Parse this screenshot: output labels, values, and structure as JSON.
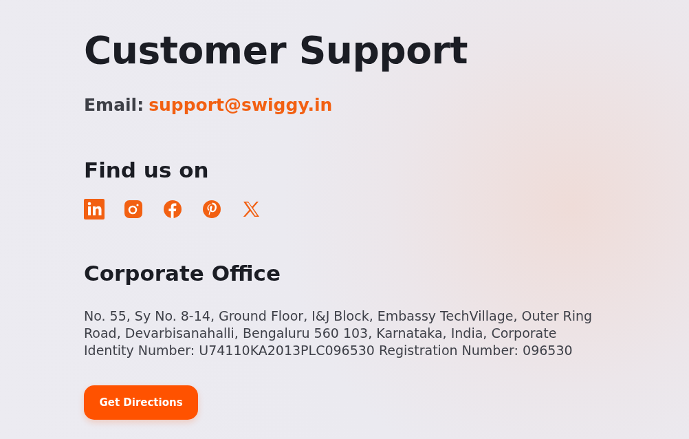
{
  "title": "Customer Support",
  "email": {
    "label": "Email:",
    "address": "support@swiggy.in"
  },
  "social": {
    "heading": "Find us on",
    "links": [
      {
        "kind": "linkedin"
      },
      {
        "kind": "instagram"
      },
      {
        "kind": "facebook"
      },
      {
        "kind": "pinterest"
      },
      {
        "kind": "x"
      }
    ]
  },
  "office": {
    "heading": "Corporate Office",
    "address": "No. 55, Sy No. 8-14, Ground Floor, I&J Block, Embassy TechVillage, Outer Ring Road, Devarbisanahalli, Bengaluru 560 103, Karnataka, India, Corporate Identity Number: U74110KA2013PLC096530 Registration Number: 096530",
    "button": "Get Directions"
  }
}
